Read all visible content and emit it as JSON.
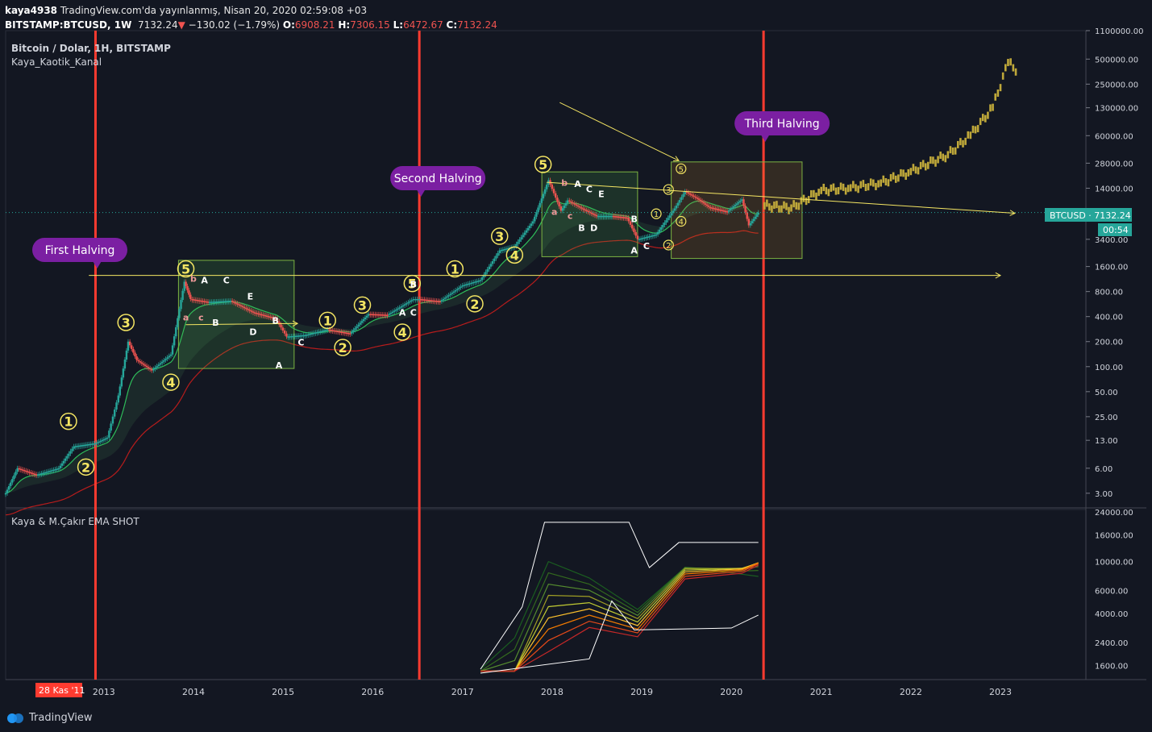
{
  "header": {
    "user": "kaya4938",
    "published": "TradingView.com'da yayınlanmış, Nisan 20, 2020 02:59:08 +03",
    "symbol": "BITSTAMP:BTCUSD, 1W",
    "price": "7132.24",
    "change": "−130.02 (−1.79%)",
    "o_label": "O:",
    "o_value": "6908.21",
    "h_label": "H:",
    "h_value": "7306.15",
    "l_label": "L:",
    "l_value": "6472.67",
    "c_label": "C:",
    "c_value": "7132.24"
  },
  "main_pane": {
    "title": "Bitcoin / Dolar, 1H, BITSTAMP",
    "indicator": "Kaya_Kaotik_Kanal",
    "price_badge": "BTCUSD · 7132.24",
    "countdown": "00:54"
  },
  "sub_pane": {
    "title": "Kaya & M.Çakır EMA SHOT"
  },
  "halvings": [
    {
      "label": "First Halving",
      "date": "2012-11-28"
    },
    {
      "label": "Second Halving",
      "date": "2016-07-09"
    },
    {
      "label": "Third Halving",
      "date": "2020-05-11"
    }
  ],
  "x_axis": {
    "start_label": "28 Kas '11",
    "years": [
      "2013",
      "2014",
      "2015",
      "2016",
      "2017",
      "2018",
      "2019",
      "2020",
      "2021",
      "2022",
      "2023"
    ]
  },
  "footer": {
    "brand": "TradingView"
  },
  "colors": {
    "bg": "#131722",
    "up": "#26a69a",
    "down": "#ef5350",
    "halving": "#ff3b30",
    "annotation": "#f5e663",
    "label_bubble": "#7b1fa2",
    "forecast": "#bfa83a"
  },
  "chart_data": {
    "type": "line",
    "scale": "log",
    "ylim": [
      2,
      1100000
    ],
    "y_ticks": [
      "1100000.00",
      "500000.00",
      "250000.00",
      "130000.00",
      "60000.00",
      "28000.00",
      "14000.00",
      "7000.00",
      "3400.00",
      "1600.00",
      "800.00",
      "400.00",
      "200.00",
      "100.00",
      "50.00",
      "25.00",
      "13.00",
      "6.00",
      "3.00"
    ],
    "series": [
      {
        "x": [
          "2011-11-28",
          "2012-01-15",
          "2012-04-01",
          "2012-07-01",
          "2012-09-01",
          "2012-11-28",
          "2013-01-15",
          "2013-03-01",
          "2013-04-10",
          "2013-05-15",
          "2013-07-15",
          "2013-10-01",
          "2013-11-25",
          "2013-12-20",
          "2014-03-01",
          "2014-06-01",
          "2014-09-01",
          "2014-12-01",
          "2015-01-15",
          "2015-04-01",
          "2015-07-01",
          "2015-10-01",
          "2015-12-15",
          "2016-03-01",
          "2016-06-15",
          "2016-07-09",
          "2016-10-01",
          "2017-01-01",
          "2017-03-15",
          "2017-06-01",
          "2017-08-01",
          "2017-10-15",
          "2017-12-17",
          "2018-02-06",
          "2018-03-05",
          "2018-05-01",
          "2018-07-01",
          "2018-09-01",
          "2018-11-01",
          "2018-12-15",
          "2019-03-01",
          "2019-05-15",
          "2019-06-26",
          "2019-08-15",
          "2019-10-01",
          "2019-12-15",
          "2020-02-13",
          "2020-03-12",
          "2020-04-20"
        ],
        "values": [
          3,
          6,
          5,
          6,
          11,
          12,
          14,
          45,
          200,
          120,
          90,
          140,
          1050,
          650,
          600,
          620,
          450,
          380,
          230,
          240,
          280,
          250,
          430,
          420,
          650,
          650,
          610,
          950,
          1100,
          2500,
          2800,
          5600,
          17500,
          7500,
          10000,
          8000,
          6500,
          6500,
          6200,
          3400,
          3900,
          8000,
          12800,
          10500,
          8300,
          7300,
          10300,
          5000,
          7132
        ]
      },
      {
        "x": [
          "2020-05-15",
          "2020-09-01",
          "2021-01-01",
          "2021-05-01",
          "2021-09-01",
          "2022-01-01",
          "2022-06-01",
          "2022-09-01",
          "2022-12-01",
          "2023-02-01",
          "2023-03-15"
        ],
        "values": [
          8500,
          8000,
          13000,
          14000,
          16000,
          22000,
          35000,
          60000,
          130000,
          450000,
          350000
        ]
      }
    ]
  }
}
